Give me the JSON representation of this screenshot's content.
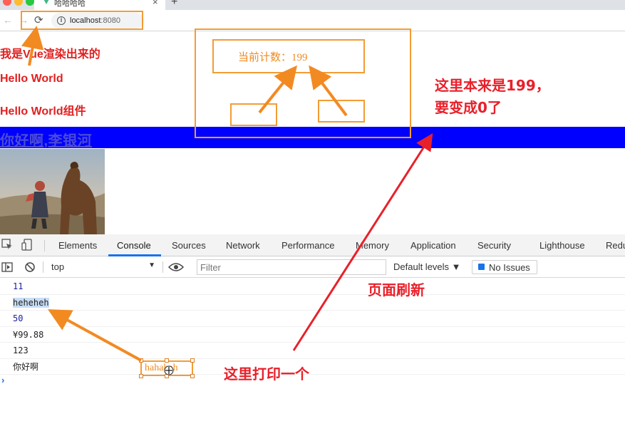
{
  "browser": {
    "tab_title": "哈哈哈哈",
    "tab_close": "×",
    "new_tab": "+",
    "url_host": "localhost",
    "url_port": ":8080"
  },
  "page": {
    "lines": [
      "我是Vue渲染出来的",
      "Hello World",
      "Hello World组件"
    ],
    "blue_link": "你好啊,李银河",
    "counter_label": "当前计数：199"
  },
  "devtools": {
    "tabs": [
      "Elements",
      "Console",
      "Sources",
      "Network",
      "Performance",
      "Memory",
      "Application",
      "Security",
      "Lighthouse",
      "Redu"
    ],
    "active_tab": "Console",
    "context": "top",
    "filter_placeholder": "Filter",
    "levels": "Default levels ▼",
    "issues": "No Issues",
    "console_lines": [
      "11",
      "heheheh",
      "50",
      "¥99.88",
      "123",
      "你好啊"
    ],
    "prompt": "›"
  },
  "annotations": {
    "note_top": "这里本来是199，",
    "note_top_2": "要变成0了",
    "note_refresh": "页面刷新",
    "note_print": "这里打印一个",
    "selected_text": "hahahah"
  },
  "colors": {
    "accent_orange": "#f39c35",
    "annotation_red": "#e8202a",
    "blue_bar": "#0000ff",
    "devtools_blue": "#1a73e8"
  }
}
